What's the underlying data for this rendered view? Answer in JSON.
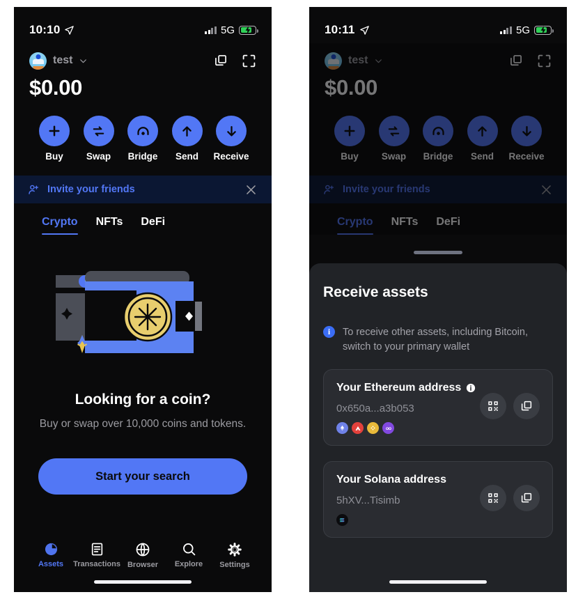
{
  "left_phone": {
    "status_bar": {
      "time": "10:10",
      "network": "5G",
      "location_icon": "location-arrow-icon"
    },
    "header": {
      "wallet_name": "test",
      "chevron_icon": "chevron-down-icon",
      "copy_icon": "copy-icon",
      "scan_icon": "scan-frame-icon",
      "avatar_icon": "avatar"
    },
    "balance": "$0.00",
    "actions": [
      {
        "label": "Buy",
        "icon": "plus-icon"
      },
      {
        "label": "Swap",
        "icon": "swap-arrows-icon"
      },
      {
        "label": "Bridge",
        "icon": "bridge-arc-icon"
      },
      {
        "label": "Send",
        "icon": "arrow-up-icon"
      },
      {
        "label": "Receive",
        "icon": "arrow-down-icon"
      }
    ],
    "invite_banner": {
      "label": "Invite your friends",
      "icon": "user-plus-icon",
      "close_icon": "close-icon"
    },
    "tabs": [
      {
        "label": "Crypto",
        "active": true
      },
      {
        "label": "NFTs",
        "active": false
      },
      {
        "label": "DeFi",
        "active": false
      }
    ],
    "empty_state": {
      "illustration": "wallet-with-coin-illustration",
      "title": "Looking for a coin?",
      "subtitle": "Buy or swap over 10,000 coins and tokens.",
      "cta_label": "Start your search"
    },
    "bottom_nav": [
      {
        "label": "Assets",
        "icon": "pie-chart-icon",
        "active": true
      },
      {
        "label": "Transactions",
        "icon": "list-document-icon",
        "active": false
      },
      {
        "label": "Browser",
        "icon": "globe-icon",
        "active": false
      },
      {
        "label": "Explore",
        "icon": "search-icon",
        "active": false
      },
      {
        "label": "Settings",
        "icon": "gear-icon",
        "active": false
      }
    ]
  },
  "right_phone": {
    "status_bar": {
      "time": "10:11",
      "network": "5G",
      "location_icon": "location-arrow-icon"
    },
    "header": {
      "wallet_name": "test",
      "chevron_icon": "chevron-down-icon",
      "copy_icon": "copy-icon",
      "scan_icon": "scan-frame-icon",
      "avatar_icon": "avatar"
    },
    "balance": "$0.00",
    "actions": [
      {
        "label": "Buy",
        "icon": "plus-icon"
      },
      {
        "label": "Swap",
        "icon": "swap-arrows-icon"
      },
      {
        "label": "Bridge",
        "icon": "bridge-arc-icon"
      },
      {
        "label": "Send",
        "icon": "arrow-up-icon"
      },
      {
        "label": "Receive",
        "icon": "arrow-down-icon"
      }
    ],
    "invite_banner": {
      "label": "Invite your friends",
      "icon": "user-plus-icon",
      "close_icon": "close-icon"
    },
    "tabs": [
      {
        "label": "Crypto",
        "active": true
      },
      {
        "label": "NFTs",
        "active": false
      },
      {
        "label": "DeFi",
        "active": false
      }
    ],
    "sheet": {
      "title": "Receive assets",
      "notice": "To receive other assets, including Bitcoin, switch to your primary wallet",
      "notice_icon": "info-icon",
      "cards": [
        {
          "title": "Your Ethereum address",
          "has_info_icon": true,
          "address": "0x650a...a3b053",
          "chains": [
            {
              "name": "ethereum",
              "color": "#6f82e8"
            },
            {
              "name": "avalanche",
              "color": "#e3413c"
            },
            {
              "name": "bnb-chain",
              "color": "#e8b93a"
            },
            {
              "name": "polygon",
              "color": "#8149e0"
            }
          ],
          "qr_button_icon": "qr-code-icon",
          "copy_button_icon": "copy-icon"
        },
        {
          "title": "Your Solana address",
          "has_info_icon": false,
          "address": "5hXV...Tisimb",
          "chains": [
            {
              "name": "solana",
              "color": "#0b0b0e"
            }
          ],
          "qr_button_icon": "qr-code-icon",
          "copy_button_icon": "copy-icon"
        }
      ]
    }
  },
  "theme": {
    "accent_blue": "#5277f5",
    "background": "#0a0a0b",
    "sheet_bg": "#212327",
    "card_bg": "#2a2c31",
    "muted_text": "#9b9ba1",
    "banner_bg": "#0b1733",
    "battery_green": "#30d158"
  }
}
